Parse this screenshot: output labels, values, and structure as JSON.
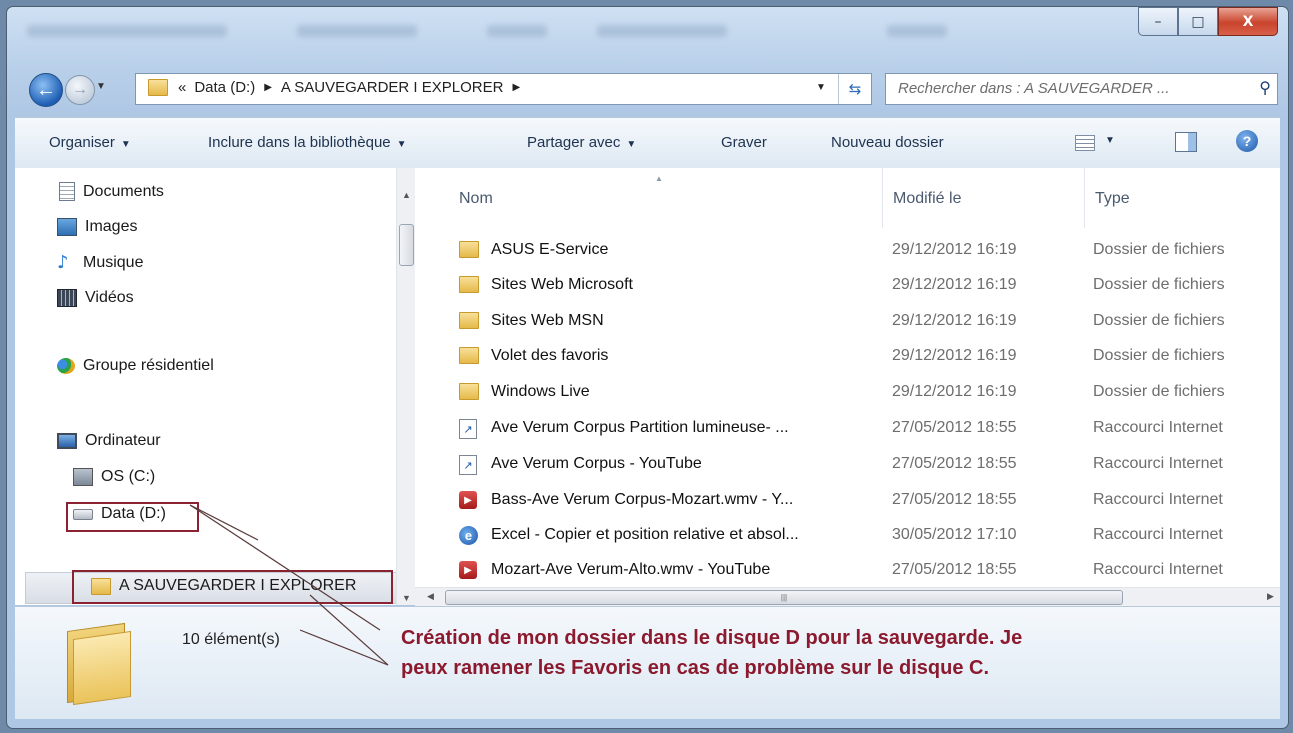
{
  "window": {
    "controls": {
      "minimize": "–",
      "maximize": "□",
      "close": "X"
    }
  },
  "nav": {
    "back_glyph": "←",
    "forward_glyph": "→",
    "address": {
      "prefix": "«",
      "crumbs": [
        "Data (D:)",
        "A SAUVEGARDER I EXPLORER"
      ]
    },
    "search_placeholder": "Rechercher dans : A SAUVEGARDER ..."
  },
  "toolbar": {
    "organize": "Organiser",
    "include_library": "Inclure dans la bibliothèque",
    "share_with": "Partager avec",
    "burn": "Graver",
    "new_folder": "Nouveau dossier",
    "help": "?"
  },
  "sidebar": {
    "items": [
      {
        "label": "Documents",
        "icon": "document-icon"
      },
      {
        "label": "Images",
        "icon": "images-icon"
      },
      {
        "label": "Musique",
        "icon": "music-icon"
      },
      {
        "label": "Vidéos",
        "icon": "videos-icon"
      },
      {
        "label": "Groupe résidentiel",
        "icon": "homegroup-icon"
      },
      {
        "label": "Ordinateur",
        "icon": "computer-icon"
      },
      {
        "label": "OS (C:)",
        "icon": "os-drive-icon"
      },
      {
        "label": "Data (D:)",
        "icon": "drive-icon"
      },
      {
        "label": "A SAUVEGARDER I EXPLORER",
        "icon": "folder-icon"
      }
    ]
  },
  "columns": {
    "name": "Nom",
    "modified": "Modifié le",
    "type": "Type"
  },
  "files": [
    {
      "name": "ASUS E-Service",
      "date": "29/12/2012 16:19",
      "type": "Dossier de fichiers",
      "icon": "folder-icon"
    },
    {
      "name": "Sites Web Microsoft",
      "date": "29/12/2012 16:19",
      "type": "Dossier de fichiers",
      "icon": "folder-icon"
    },
    {
      "name": "Sites Web MSN",
      "date": "29/12/2012 16:19",
      "type": "Dossier de fichiers",
      "icon": "folder-icon"
    },
    {
      "name": "Volet des favoris",
      "date": "29/12/2012 16:19",
      "type": "Dossier de fichiers",
      "icon": "folder-icon"
    },
    {
      "name": "Windows Live",
      "date": "29/12/2012 16:19",
      "type": "Dossier de fichiers",
      "icon": "folder-icon"
    },
    {
      "name": "Ave Verum Corpus  Partition lumineuse- ...",
      "date": "27/05/2012 18:55",
      "type": "Raccourci Internet",
      "icon": "internet-shortcut-icon"
    },
    {
      "name": "Ave Verum Corpus - YouTube",
      "date": "27/05/2012 18:55",
      "type": "Raccourci Internet",
      "icon": "internet-shortcut-icon"
    },
    {
      "name": "Bass-Ave Verum Corpus-Mozart.wmv - Y...",
      "date": "27/05/2012 18:55",
      "type": "Raccourci Internet",
      "icon": "youtube-shortcut-icon"
    },
    {
      "name": "Excel - Copier et position relative et absol...",
      "date": "30/05/2012 17:10",
      "type": "Raccourci Internet",
      "icon": "ie-shortcut-icon"
    },
    {
      "name": "Mozart-Ave Verum-Alto.wmv - YouTube",
      "date": "27/05/2012 18:55",
      "type": "Raccourci Internet",
      "icon": "youtube-shortcut-icon"
    }
  ],
  "details": {
    "count": "10 élément(s)"
  },
  "annotation": {
    "line1": "Création de mon dossier dans le disque D pour la sauvegarde. Je",
    "line2": "peux ramener les Favoris en cas de problème sur le disque C."
  },
  "colors": {
    "annotation": "#8b1a2e",
    "highlight_box": "#8b2232"
  }
}
